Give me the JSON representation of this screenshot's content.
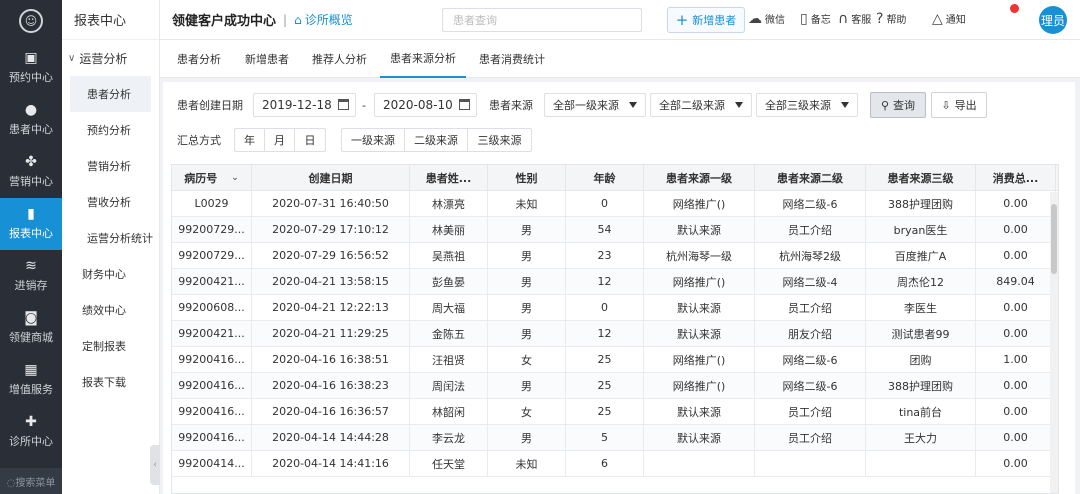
{
  "nav": {
    "logo_glyph": "☺",
    "items": [
      {
        "label": "预约中心",
        "icon": "calendar-icon",
        "glyph": "▣"
      },
      {
        "label": "患者中心",
        "icon": "user-icon",
        "glyph": "●"
      },
      {
        "label": "营销中心",
        "icon": "pinwheel-icon",
        "glyph": "✤"
      },
      {
        "label": "报表中心",
        "icon": "bar-chart-icon",
        "glyph": "▮",
        "active": true
      },
      {
        "label": "进销存",
        "icon": "layers-icon",
        "glyph": "≋"
      },
      {
        "label": "领健商城",
        "icon": "shop-icon",
        "glyph": "◙"
      },
      {
        "label": "增值服务",
        "icon": "grid-icon",
        "glyph": "▦"
      },
      {
        "label": "诊所中心",
        "icon": "clinic-icon",
        "glyph": "✚"
      }
    ],
    "search_label": "◌搜索菜单"
  },
  "subnav": {
    "title": "报表中心",
    "group": "运营分析",
    "items": [
      "患者分析",
      "预约分析",
      "营销分析",
      "营收分析",
      "运营分析统计"
    ],
    "active_item": "患者分析",
    "top_items": [
      "财务中心",
      "绩效中心",
      "定制报表",
      "报表下载"
    ]
  },
  "header": {
    "title": "领健客户成功中心",
    "separator": "|",
    "overview": "诊所概览",
    "search_placeholder": "患者查询",
    "add_patient": "新增患者",
    "tools": [
      {
        "label": "微信",
        "icon": "wechat-icon",
        "glyph": "☁"
      },
      {
        "label": "备忘",
        "icon": "memo-icon",
        "glyph": "▯"
      },
      {
        "label": "客服",
        "icon": "headset-icon",
        "glyph": "∩"
      },
      {
        "label": "帮助",
        "icon": "help-icon",
        "glyph": "?"
      },
      {
        "label": "通知",
        "icon": "bell-icon",
        "glyph": "△"
      }
    ],
    "avatar": "理员"
  },
  "tabs": [
    "患者分析",
    "新增患者",
    "推荐人分析",
    "患者来源分析",
    "患者消费统计"
  ],
  "active_tab": "患者来源分析",
  "filters": {
    "date_label": "患者创建日期",
    "start_date": "2019-12-18",
    "date_sep": "-",
    "end_date": "2020-08-10",
    "source_label": "患者来源",
    "source_l1": "全部一级来源",
    "source_l2": "全部二级来源",
    "source_l3": "全部三级来源",
    "query_button": "查询",
    "export_button": "导出",
    "summary_label": "汇总方式",
    "summary_options": [
      "年",
      "月",
      "日"
    ],
    "source_level_options": [
      "一级来源",
      "二级来源",
      "三级来源"
    ]
  },
  "table": {
    "columns": [
      "病历号",
      "创建日期",
      "患者姓...",
      "性别",
      "年龄",
      "患者来源一级",
      "患者来源二级",
      "患者来源三级",
      "消费总..."
    ],
    "rows": [
      [
        "L0029",
        "2020-07-31 16:40:50",
        "林漂亮",
        "未知",
        "0",
        "网络推广()",
        "网络二级-6",
        "388护理团购",
        "0.00"
      ],
      [
        "99200729...",
        "2020-07-29 17:10:12",
        "林美丽",
        "男",
        "54",
        "默认来源",
        "员工介绍",
        "bryan医生",
        "0.00"
      ],
      [
        "99200729...",
        "2020-07-29 16:56:52",
        "吴燕祖",
        "男",
        "23",
        "杭州海琴一级",
        "杭州海琴2级",
        "百度推广A",
        "0.00"
      ],
      [
        "99200421...",
        "2020-04-21 13:58:15",
        "彭鱼晏",
        "男",
        "12",
        "网络推广()",
        "网络二级-4",
        "周杰伦12",
        "849.04"
      ],
      [
        "99200608...",
        "2020-04-21 12:22:13",
        "周大福",
        "男",
        "0",
        "默认来源",
        "员工介绍",
        "李医生",
        "0.00"
      ],
      [
        "99200421...",
        "2020-04-21 11:29:25",
        "金陈五",
        "男",
        "12",
        "默认来源",
        "朋友介绍",
        "测试患者99",
        "0.00"
      ],
      [
        "99200416...",
        "2020-04-16 16:38:51",
        "汪祖贤",
        "女",
        "25",
        "网络推广()",
        "网络二级-6",
        "团购",
        "1.00"
      ],
      [
        "99200416...",
        "2020-04-16 16:38:23",
        "周闰法",
        "男",
        "25",
        "网络推广()",
        "网络二级-6",
        "388护理团购",
        "0.00"
      ],
      [
        "99200416...",
        "2020-04-16 16:36:57",
        "林韶闲",
        "女",
        "25",
        "默认来源",
        "员工介绍",
        "tina前台",
        "0.00"
      ],
      [
        "99200416...",
        "2020-04-14 14:44:28",
        "李云龙",
        "男",
        "5",
        "默认来源",
        "员工介绍",
        "王大力",
        "0.00"
      ],
      [
        "99200414...",
        "2020-04-14 14:41:16",
        "任天堂",
        "未知",
        "6",
        "",
        "",
        "",
        "0.00"
      ]
    ]
  }
}
